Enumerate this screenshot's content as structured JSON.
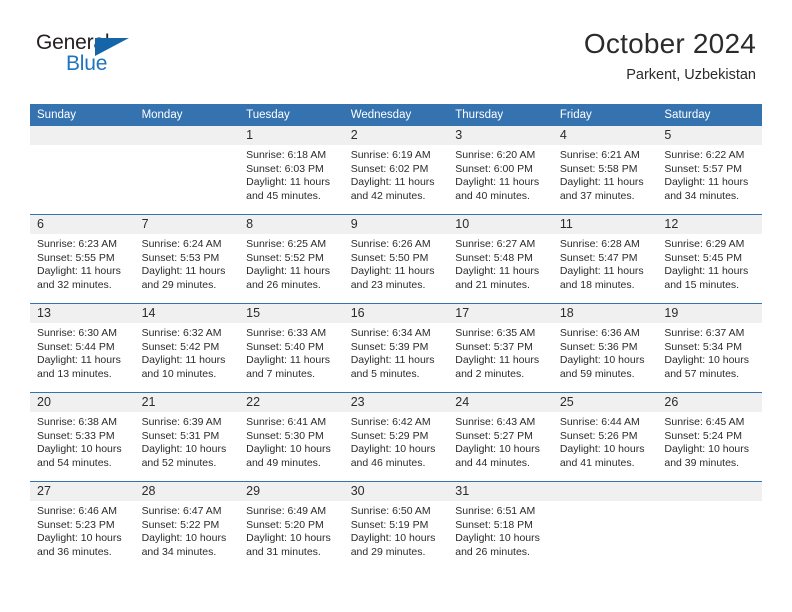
{
  "brand": {
    "name_top": "General",
    "name_bottom": "Blue",
    "accent_color": "#1f74bd",
    "triangle_color": "#1565a8"
  },
  "header": {
    "title": "October 2024",
    "subtitle": "Parkent, Uzbekistan"
  },
  "theme": {
    "header_blue": "#3572b0",
    "daynum_gray": "#f0f0f0",
    "text": "#2b2b2b"
  },
  "weekdays": [
    "Sunday",
    "Monday",
    "Tuesday",
    "Wednesday",
    "Thursday",
    "Friday",
    "Saturday"
  ],
  "weeks": [
    [
      {
        "day": "",
        "blank": true
      },
      {
        "day": "",
        "blank": true
      },
      {
        "day": "1",
        "sunrise": "Sunrise: 6:18 AM",
        "sunset": "Sunset: 6:03 PM",
        "daylight_1": "Daylight: 11 hours",
        "daylight_2": "and 45 minutes."
      },
      {
        "day": "2",
        "sunrise": "Sunrise: 6:19 AM",
        "sunset": "Sunset: 6:02 PM",
        "daylight_1": "Daylight: 11 hours",
        "daylight_2": "and 42 minutes."
      },
      {
        "day": "3",
        "sunrise": "Sunrise: 6:20 AM",
        "sunset": "Sunset: 6:00 PM",
        "daylight_1": "Daylight: 11 hours",
        "daylight_2": "and 40 minutes."
      },
      {
        "day": "4",
        "sunrise": "Sunrise: 6:21 AM",
        "sunset": "Sunset: 5:58 PM",
        "daylight_1": "Daylight: 11 hours",
        "daylight_2": "and 37 minutes."
      },
      {
        "day": "5",
        "sunrise": "Sunrise: 6:22 AM",
        "sunset": "Sunset: 5:57 PM",
        "daylight_1": "Daylight: 11 hours",
        "daylight_2": "and 34 minutes."
      }
    ],
    [
      {
        "day": "6",
        "sunrise": "Sunrise: 6:23 AM",
        "sunset": "Sunset: 5:55 PM",
        "daylight_1": "Daylight: 11 hours",
        "daylight_2": "and 32 minutes."
      },
      {
        "day": "7",
        "sunrise": "Sunrise: 6:24 AM",
        "sunset": "Sunset: 5:53 PM",
        "daylight_1": "Daylight: 11 hours",
        "daylight_2": "and 29 minutes."
      },
      {
        "day": "8",
        "sunrise": "Sunrise: 6:25 AM",
        "sunset": "Sunset: 5:52 PM",
        "daylight_1": "Daylight: 11 hours",
        "daylight_2": "and 26 minutes."
      },
      {
        "day": "9",
        "sunrise": "Sunrise: 6:26 AM",
        "sunset": "Sunset: 5:50 PM",
        "daylight_1": "Daylight: 11 hours",
        "daylight_2": "and 23 minutes."
      },
      {
        "day": "10",
        "sunrise": "Sunrise: 6:27 AM",
        "sunset": "Sunset: 5:48 PM",
        "daylight_1": "Daylight: 11 hours",
        "daylight_2": "and 21 minutes."
      },
      {
        "day": "11",
        "sunrise": "Sunrise: 6:28 AM",
        "sunset": "Sunset: 5:47 PM",
        "daylight_1": "Daylight: 11 hours",
        "daylight_2": "and 18 minutes."
      },
      {
        "day": "12",
        "sunrise": "Sunrise: 6:29 AM",
        "sunset": "Sunset: 5:45 PM",
        "daylight_1": "Daylight: 11 hours",
        "daylight_2": "and 15 minutes."
      }
    ],
    [
      {
        "day": "13",
        "sunrise": "Sunrise: 6:30 AM",
        "sunset": "Sunset: 5:44 PM",
        "daylight_1": "Daylight: 11 hours",
        "daylight_2": "and 13 minutes."
      },
      {
        "day": "14",
        "sunrise": "Sunrise: 6:32 AM",
        "sunset": "Sunset: 5:42 PM",
        "daylight_1": "Daylight: 11 hours",
        "daylight_2": "and 10 minutes."
      },
      {
        "day": "15",
        "sunrise": "Sunrise: 6:33 AM",
        "sunset": "Sunset: 5:40 PM",
        "daylight_1": "Daylight: 11 hours",
        "daylight_2": "and 7 minutes."
      },
      {
        "day": "16",
        "sunrise": "Sunrise: 6:34 AM",
        "sunset": "Sunset: 5:39 PM",
        "daylight_1": "Daylight: 11 hours",
        "daylight_2": "and 5 minutes."
      },
      {
        "day": "17",
        "sunrise": "Sunrise: 6:35 AM",
        "sunset": "Sunset: 5:37 PM",
        "daylight_1": "Daylight: 11 hours",
        "daylight_2": "and 2 minutes."
      },
      {
        "day": "18",
        "sunrise": "Sunrise: 6:36 AM",
        "sunset": "Sunset: 5:36 PM",
        "daylight_1": "Daylight: 10 hours",
        "daylight_2": "and 59 minutes."
      },
      {
        "day": "19",
        "sunrise": "Sunrise: 6:37 AM",
        "sunset": "Sunset: 5:34 PM",
        "daylight_1": "Daylight: 10 hours",
        "daylight_2": "and 57 minutes."
      }
    ],
    [
      {
        "day": "20",
        "sunrise": "Sunrise: 6:38 AM",
        "sunset": "Sunset: 5:33 PM",
        "daylight_1": "Daylight: 10 hours",
        "daylight_2": "and 54 minutes."
      },
      {
        "day": "21",
        "sunrise": "Sunrise: 6:39 AM",
        "sunset": "Sunset: 5:31 PM",
        "daylight_1": "Daylight: 10 hours",
        "daylight_2": "and 52 minutes."
      },
      {
        "day": "22",
        "sunrise": "Sunrise: 6:41 AM",
        "sunset": "Sunset: 5:30 PM",
        "daylight_1": "Daylight: 10 hours",
        "daylight_2": "and 49 minutes."
      },
      {
        "day": "23",
        "sunrise": "Sunrise: 6:42 AM",
        "sunset": "Sunset: 5:29 PM",
        "daylight_1": "Daylight: 10 hours",
        "daylight_2": "and 46 minutes."
      },
      {
        "day": "24",
        "sunrise": "Sunrise: 6:43 AM",
        "sunset": "Sunset: 5:27 PM",
        "daylight_1": "Daylight: 10 hours",
        "daylight_2": "and 44 minutes."
      },
      {
        "day": "25",
        "sunrise": "Sunrise: 6:44 AM",
        "sunset": "Sunset: 5:26 PM",
        "daylight_1": "Daylight: 10 hours",
        "daylight_2": "and 41 minutes."
      },
      {
        "day": "26",
        "sunrise": "Sunrise: 6:45 AM",
        "sunset": "Sunset: 5:24 PM",
        "daylight_1": "Daylight: 10 hours",
        "daylight_2": "and 39 minutes."
      }
    ],
    [
      {
        "day": "27",
        "sunrise": "Sunrise: 6:46 AM",
        "sunset": "Sunset: 5:23 PM",
        "daylight_1": "Daylight: 10 hours",
        "daylight_2": "and 36 minutes."
      },
      {
        "day": "28",
        "sunrise": "Sunrise: 6:47 AM",
        "sunset": "Sunset: 5:22 PM",
        "daylight_1": "Daylight: 10 hours",
        "daylight_2": "and 34 minutes."
      },
      {
        "day": "29",
        "sunrise": "Sunrise: 6:49 AM",
        "sunset": "Sunset: 5:20 PM",
        "daylight_1": "Daylight: 10 hours",
        "daylight_2": "and 31 minutes."
      },
      {
        "day": "30",
        "sunrise": "Sunrise: 6:50 AM",
        "sunset": "Sunset: 5:19 PM",
        "daylight_1": "Daylight: 10 hours",
        "daylight_2": "and 29 minutes."
      },
      {
        "day": "31",
        "sunrise": "Sunrise: 6:51 AM",
        "sunset": "Sunset: 5:18 PM",
        "daylight_1": "Daylight: 10 hours",
        "daylight_2": "and 26 minutes."
      },
      {
        "day": "",
        "blank": true
      },
      {
        "day": "",
        "blank": true
      }
    ]
  ]
}
